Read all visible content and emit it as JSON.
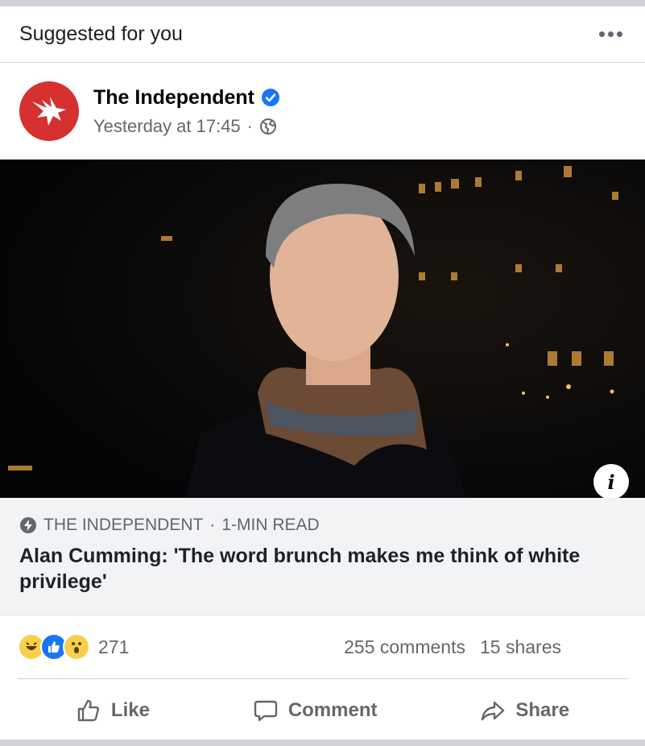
{
  "suggested": {
    "label": "Suggested for you"
  },
  "post": {
    "page_name": "The Independent",
    "time": "Yesterday at 17:45",
    "separator": "·",
    "audience_icon": "globe-icon",
    "verified_icon": "verified-badge-icon"
  },
  "link": {
    "source": "THE INDEPENDENT",
    "separator": "·",
    "read_time": "1-MIN READ",
    "title": "Alan Cumming: 'The word brunch makes me think of white privilege'",
    "info_label": "i"
  },
  "stats": {
    "reactions": [
      "haha",
      "like",
      "wow"
    ],
    "reaction_count": "271",
    "comments": "255 comments",
    "shares": "15 shares"
  },
  "actions": {
    "like": "Like",
    "comment": "Comment",
    "share": "Share"
  },
  "colors": {
    "accent": "#1877f2",
    "brand_red": "#d63030",
    "muted": "#65676b"
  }
}
